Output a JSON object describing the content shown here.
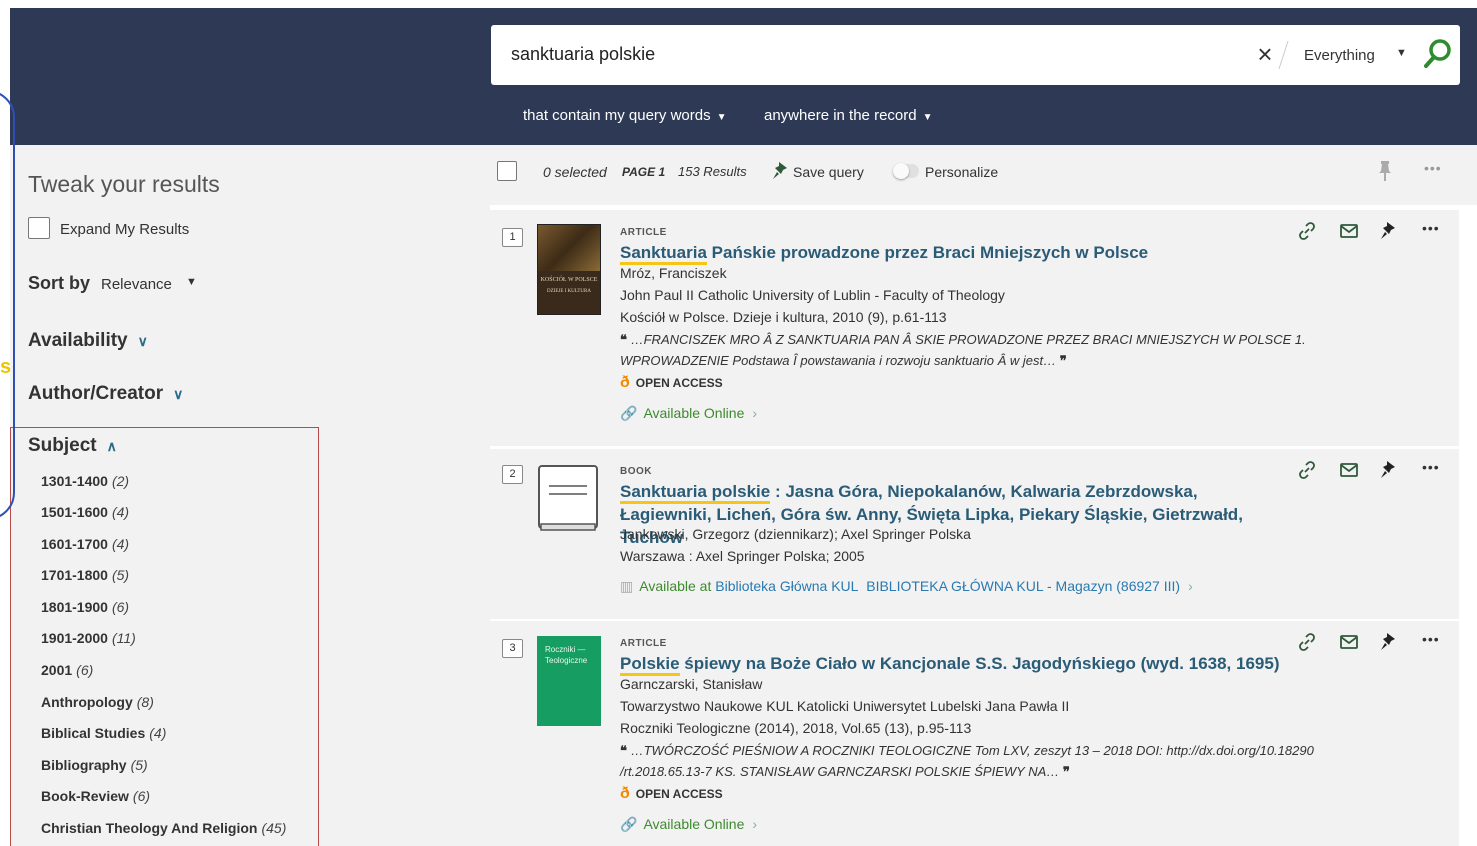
{
  "search": {
    "query": "sanktuaria polskie",
    "scope": "Everything",
    "match_option": "that contain my query words",
    "field_option": "anywhere in the record"
  },
  "left_edge_letter": "s",
  "sidebar": {
    "title": "Tweak your results",
    "expand_label": "Expand My Results",
    "sort_label": "Sort by",
    "sort_value": "Relevance",
    "facets": [
      "Availability",
      "Author/Creator",
      "Subject"
    ],
    "subjects": [
      {
        "label": "1301-1400",
        "count": "(2)"
      },
      {
        "label": "1501-1600",
        "count": "(4)"
      },
      {
        "label": "1601-1700",
        "count": "(4)"
      },
      {
        "label": "1701-1800",
        "count": "(5)"
      },
      {
        "label": "1801-1900",
        "count": "(6)"
      },
      {
        "label": "1901-2000",
        "count": "(11)"
      },
      {
        "label": "2001",
        "count": "(6)"
      },
      {
        "label": "Anthropology",
        "count": "(8)"
      },
      {
        "label": "Biblical Studies",
        "count": "(4)"
      },
      {
        "label": "Bibliography",
        "count": "(5)"
      },
      {
        "label": "Book-Review",
        "count": "(6)"
      },
      {
        "label": "Christian Theology And Religion",
        "count": "(45)"
      }
    ]
  },
  "results_bar": {
    "selected": "0 selected",
    "page": "PAGE 1",
    "count": "153 Results",
    "save_query": "Save query",
    "personalize": "Personalize"
  },
  "results": [
    {
      "number": "1",
      "type": "ARTICLE",
      "title_highlight": "Sanktuaria",
      "title_rest": " Pańskie prowadzone przez Braci Mniejszych w Polsce",
      "author": "Mróz, Franciszek",
      "publisher": "John Paul II Catholic University of Lublin - Faculty of Theology",
      "source": "Kościół w Polsce. Dzieje i kultura, 2010 (9), p.61-113",
      "snippet": "…FRANCISZEK MRO Â Z SANKTUARIA PAN Â SKIE PROWADZONE PRZEZ BRACI MNIEJSZYCH W POLSCE 1. WPROWADZENIE Podstawa Î powstawania i rozwoju sanktuario Â w jest…",
      "open_access": "OPEN ACCESS",
      "availability": "Available Online",
      "thumb_title": "KOŚCIÓŁ W POLSCE",
      "thumb_sub": "DZIEJE I KULTURA"
    },
    {
      "number": "2",
      "type": "BOOK",
      "title_highlight": "Sanktuaria polskie",
      "title_rest": " : Jasna Góra, Niepokalanów, Kalwaria Zebrzdowska, Łagiewniki, Licheń, Góra św. Anny, Święta Lipka, Piekary Śląskie, Gietrzwałd, Tuchów",
      "author": "Jankowski, Grzegorz (dziennikarz); Axel Springer Polska",
      "publisher": "Warszawa : Axel Springer Polska; 2005",
      "availability_prefix": "Available at",
      "availability_library": "Biblioteka Główna KUL",
      "availability_location": "BIBLIOTEKA GŁÓWNA KUL - Magazyn (86927 III)"
    },
    {
      "number": "3",
      "type": "ARTICLE",
      "title_highlight": "Polskie",
      "title_rest": " śpiewy na Boże Ciało w Kancjonale S.S. Jagodyńskiego (wyd. 1638, 1695)",
      "author": "Garnczarski, Stanisław",
      "publisher": "Towarzystwo Naukowe KUL Katolicki Uniwersytet Lubelski Jana Pawła II",
      "source": "Roczniki Teologiczne (2014), 2018, Vol.65 (13), p.95-113",
      "snippet": "…TWÓRCZOŚĆ PIEŚNIOW A ROCZNIKI TEOLOGICZNE Tom LXV, zeszyt 13 – 2018 DOI: http://dx.doi.org/10.18290 /rt.2018.65.13-7 KS. STANISŁAW GARNCZARSKI POLSKIE ŚPIEWY NA…",
      "open_access": "OPEN ACCESS",
      "availability": "Available Online",
      "thumb_title": "Roczniki — Teologiczne"
    }
  ],
  "colors": {
    "header_bg": "#2e3a55",
    "panel_bg": "#f2f2f2",
    "title_link": "#2a5b77",
    "highlight": "#f5c518",
    "available_green": "#3e8a2e",
    "open_access_orange": "#f08a00",
    "search_green": "#2e8b2e"
  }
}
